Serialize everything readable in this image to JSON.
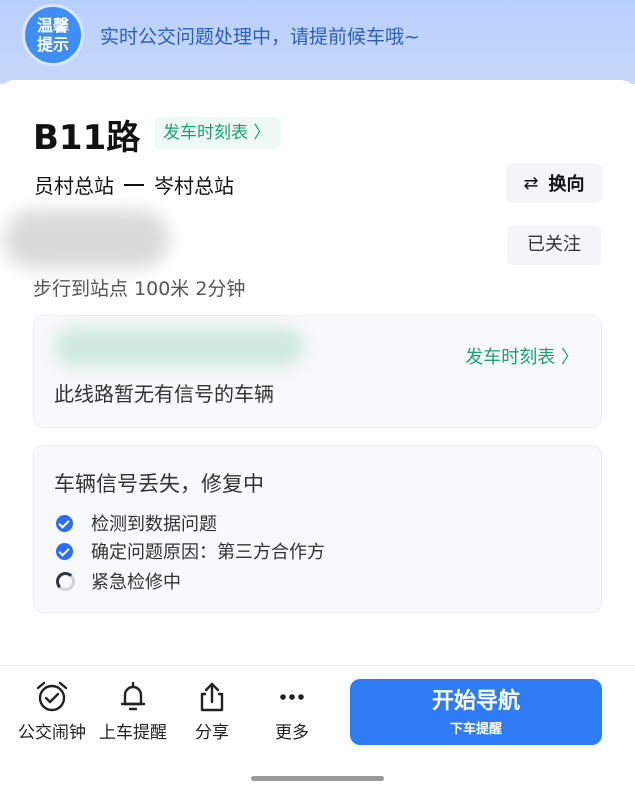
{
  "banner": {
    "badge_line1": "温馨",
    "badge_line2": "提示",
    "message": "实时公交问题处理中，请提前候车哦~"
  },
  "route": {
    "name": "B11路",
    "schedule_label": "发车时刻表 〉",
    "from": "员村总站",
    "to": "岑村总站",
    "switch_icon": "⇄",
    "switch_label": "换向",
    "follow_label": "已关注",
    "walk_info": "步行到站点 100米 2分钟"
  },
  "vehicle_card": {
    "schedule_link": "发车时刻表 〉",
    "no_signal": "此线路暂无有信号的车辆"
  },
  "status_card": {
    "title": "车辆信号丢失，修复中",
    "steps": [
      {
        "label": "检测到数据问题",
        "state": "done"
      },
      {
        "label": "确定问题原因：第三方合作方",
        "state": "done"
      },
      {
        "label": "紧急检修中",
        "state": "in-progress"
      }
    ]
  },
  "bottom": {
    "actions": [
      {
        "label": "公交闹钟",
        "icon": "alarm-clock-icon"
      },
      {
        "label": "上车提醒",
        "icon": "bell-icon"
      },
      {
        "label": "分享",
        "icon": "share-icon"
      },
      {
        "label": "更多",
        "icon": "more-icon"
      }
    ],
    "nav_main": "开始导航",
    "nav_sub": "下车提醒"
  },
  "colors": {
    "accent": "#2f7cf6",
    "green": "#1f9e72",
    "banner_text": "#2a5fb8"
  }
}
